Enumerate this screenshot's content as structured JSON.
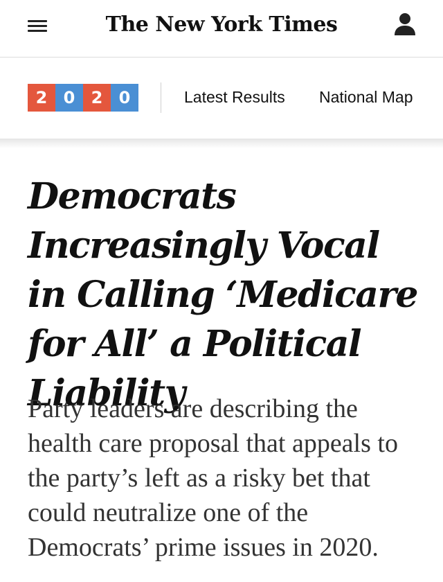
{
  "masthead": {
    "logo_text": "The New York Times",
    "menu_icon": "hamburger-menu-icon",
    "account_icon": "user-account-icon"
  },
  "election_nav": {
    "badge_digits": [
      "2",
      "0",
      "2",
      "0"
    ],
    "badge_colors": [
      "#e4573d",
      "#4a8fd4",
      "#e4573d",
      "#4a8fd4"
    ],
    "links": {
      "latest_results": "Latest Results",
      "national_map": "National Map"
    }
  },
  "article": {
    "headline": "Democrats Increasingly Vocal in Calling ‘Medicare for All’ a Political Liability",
    "summary": "Party leaders are describing the health care proposal that appeals to the party’s left as a risky bet that could neutralize one of the Democrats’ prime issues in 2020."
  }
}
